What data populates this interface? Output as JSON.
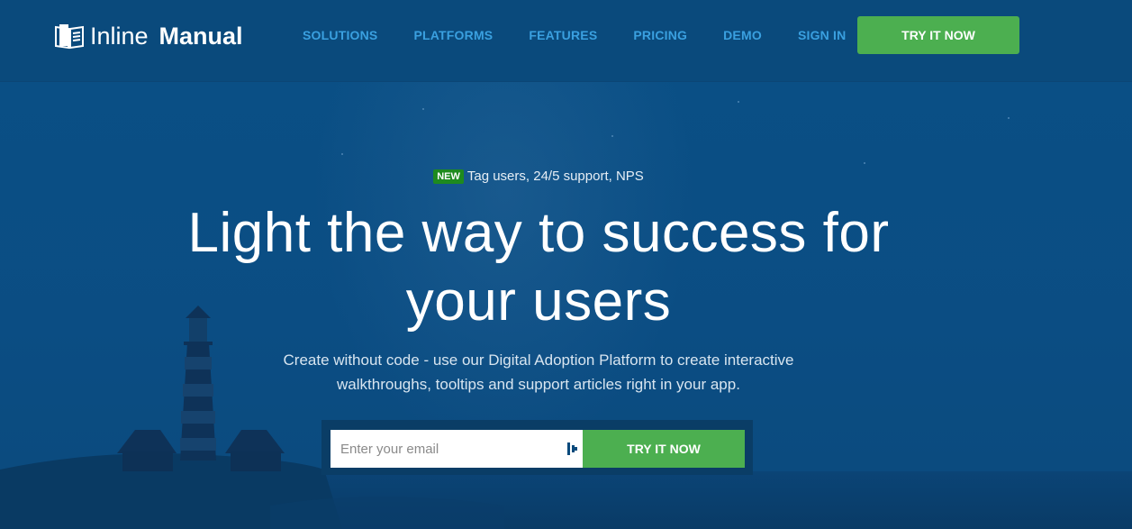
{
  "header": {
    "brand_light": "Inline",
    "brand_bold": "Manual",
    "logo_icon": "book-icon",
    "nav": [
      {
        "label": "SOLUTIONS"
      },
      {
        "label": "PLATFORMS"
      },
      {
        "label": "FEATURES"
      },
      {
        "label": "PRICING"
      },
      {
        "label": "DEMO"
      },
      {
        "label": "SIGN IN"
      }
    ],
    "cta_label": "TRY IT NOW"
  },
  "hero": {
    "badge": "NEW",
    "badge_text": "Tag users, 24/5 support, NPS",
    "headline_line1": "Light the way to success for",
    "headline_line2": "your users",
    "subtext_line1": "Create without code - use our Digital Adoption Platform to create interactive",
    "subtext_line2": "walkthroughs, tooltips and support articles right in your app.",
    "email_placeholder": "Enter your email",
    "email_value": "",
    "form_cta_label": "TRY IT NOW"
  },
  "colors": {
    "header_bg": "#0a4a7c",
    "nav_link": "#3aa0e0",
    "cta_green": "#4caf50",
    "badge_green": "#1e8a1e",
    "hero_bg": "#0b4d83"
  }
}
